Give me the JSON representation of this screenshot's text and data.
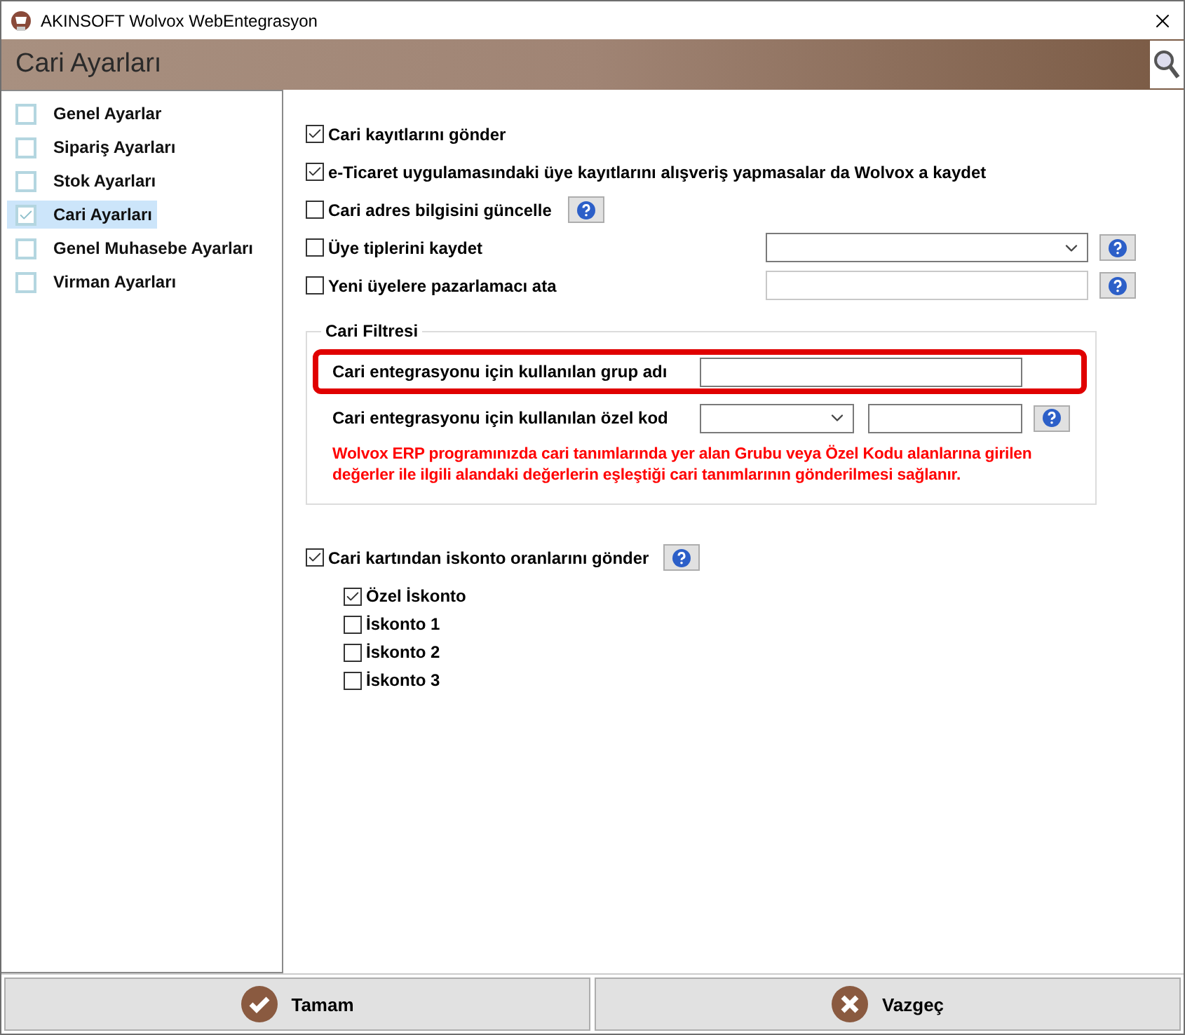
{
  "window": {
    "title": "AKINSOFT Wolvox WebEntegrasyon"
  },
  "header": {
    "title": "Cari Ayarları"
  },
  "sidebar": {
    "items": [
      {
        "label": "Genel Ayarlar",
        "checked": false,
        "selected": false
      },
      {
        "label": "Sipariş Ayarları",
        "checked": false,
        "selected": false
      },
      {
        "label": "Stok Ayarları",
        "checked": false,
        "selected": false
      },
      {
        "label": "Cari Ayarları",
        "checked": true,
        "selected": true
      },
      {
        "label": "Genel Muhasebe Ayarları",
        "checked": false,
        "selected": false
      },
      {
        "label": "Virman Ayarları",
        "checked": false,
        "selected": false
      }
    ]
  },
  "options": [
    {
      "kind": "plain",
      "label": "Cari kayıtlarını gönder",
      "checked": true
    },
    {
      "kind": "plain",
      "label": "e-Ticaret uygulamasındaki üye kayıtlarını alışveriş yapmasalar da Wolvox a kaydet",
      "checked": true
    },
    {
      "kind": "help",
      "label": "Cari adres bilgisini güncelle",
      "checked": false
    },
    {
      "kind": "dropdown",
      "label": "Üye tiplerini kaydet",
      "checked": false
    },
    {
      "kind": "text",
      "label": "Yeni üyelere pazarlamacı ata",
      "checked": false
    }
  ],
  "filter": {
    "title": "Cari Filtresi",
    "rows": [
      {
        "kind": "text",
        "label": "Cari entegrasyonu için kullanılan grup adı",
        "highlighted": true
      },
      {
        "kind": "dropdown_text",
        "label": "Cari entegrasyonu için kullanılan özel kod",
        "highlighted": false
      }
    ],
    "note": "Wolvox ERP programınızda cari tanımlarında yer alan Grubu veya Özel Kodu alanlarına girilen değerler ile ilgili alandaki değerlerin eşleştiği cari tanımlarının gönderilmesi sağlanır."
  },
  "discount": {
    "label": "Cari kartından iskonto oranlarını gönder",
    "checked": true,
    "items": [
      {
        "label": "Özel İskonto",
        "checked": true
      },
      {
        "label": "İskonto 1",
        "checked": false
      },
      {
        "label": "İskonto 2",
        "checked": false
      },
      {
        "label": "İskonto 3",
        "checked": false
      }
    ]
  },
  "buttons": [
    {
      "kind": "ok",
      "label": "Tamam"
    },
    {
      "kind": "cancel",
      "label": "Vazgeç"
    }
  ]
}
